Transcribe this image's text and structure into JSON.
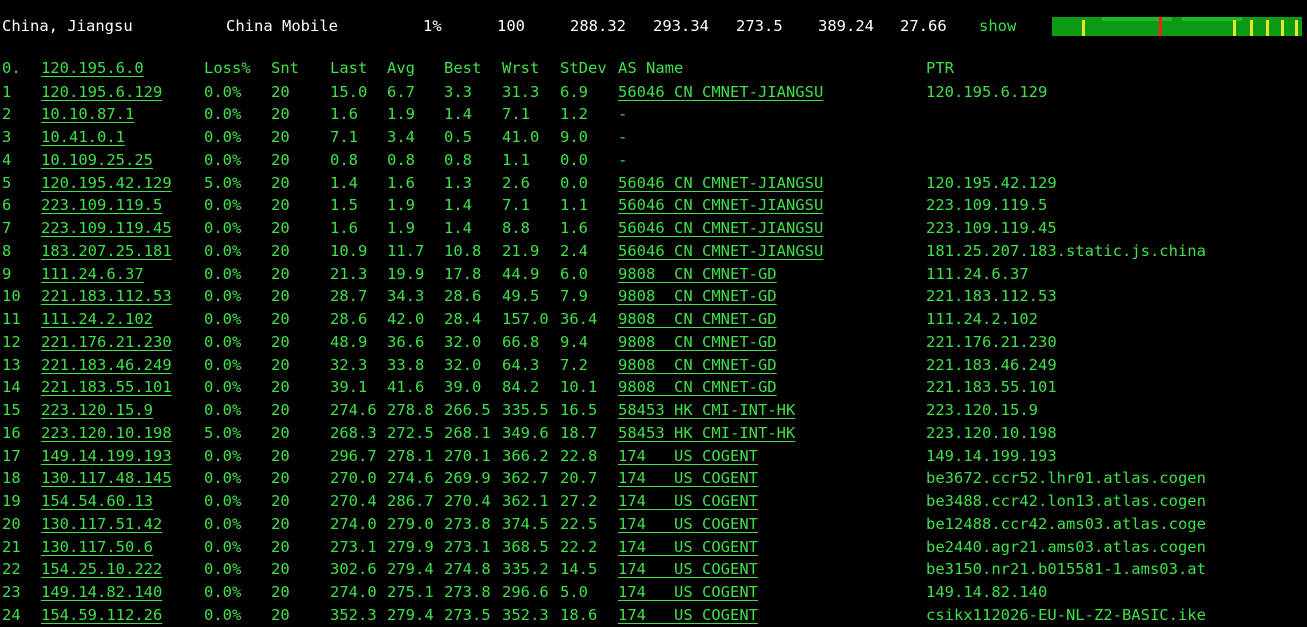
{
  "summary": {
    "location": "China, Jiangsu",
    "isp": "China Mobile",
    "loss": "1%",
    "sent": "100",
    "last": "288.32",
    "avg": "293.34",
    "best": "273.5",
    "worst": "389.24",
    "stdev": "27.66",
    "show_label": "show"
  },
  "colors": {
    "text": "#3fe04a",
    "background": "#000000",
    "graph_bg": "#0a9a14",
    "graph_tick": "#e8e62b",
    "graph_peak": "#ff1a1a"
  },
  "table": {
    "headers": {
      "hop": "0.",
      "host": "120.195.6.0",
      "loss": "Loss%",
      "snt": "Snt",
      "last": "Last",
      "avg": "Avg",
      "best": "Best",
      "wrst": "Wrst",
      "stdev": "StDev",
      "as": "AS Name",
      "ptr": "PTR"
    },
    "rows": [
      {
        "hop": "1",
        "host": "120.195.6.129",
        "loss": "0.0%",
        "snt": "20",
        "last": "15.0",
        "avg": "6.7",
        "best": "3.3",
        "wrst": "31.3",
        "stdev": "6.9",
        "as": "56046 CN CMNET-JIANGSU",
        "ptr": "120.195.6.129"
      },
      {
        "hop": "2",
        "host": "10.10.87.1",
        "loss": "0.0%",
        "snt": "20",
        "last": "1.6",
        "avg": "1.9",
        "best": "1.4",
        "wrst": "7.1",
        "stdev": "1.2",
        "as": "-",
        "ptr": ""
      },
      {
        "hop": "3",
        "host": "10.41.0.1",
        "loss": "0.0%",
        "snt": "20",
        "last": "7.1",
        "avg": "3.4",
        "best": "0.5",
        "wrst": "41.0",
        "stdev": "9.0",
        "as": "-",
        "ptr": ""
      },
      {
        "hop": "4",
        "host": "10.109.25.25",
        "loss": "0.0%",
        "snt": "20",
        "last": "0.8",
        "avg": "0.8",
        "best": "0.8",
        "wrst": "1.1",
        "stdev": "0.0",
        "as": "-",
        "ptr": ""
      },
      {
        "hop": "5",
        "host": "120.195.42.129",
        "loss": "5.0%",
        "snt": "20",
        "last": "1.4",
        "avg": "1.6",
        "best": "1.3",
        "wrst": "2.6",
        "stdev": "0.0",
        "as": "56046 CN CMNET-JIANGSU",
        "ptr": "120.195.42.129"
      },
      {
        "hop": "6",
        "host": "223.109.119.5",
        "loss": "0.0%",
        "snt": "20",
        "last": "1.5",
        "avg": "1.9",
        "best": "1.4",
        "wrst": "7.1",
        "stdev": "1.1",
        "as": "56046 CN CMNET-JIANGSU",
        "ptr": "223.109.119.5"
      },
      {
        "hop": "7",
        "host": "223.109.119.45",
        "loss": "0.0%",
        "snt": "20",
        "last": "1.6",
        "avg": "1.9",
        "best": "1.4",
        "wrst": "8.8",
        "stdev": "1.6",
        "as": "56046 CN CMNET-JIANGSU",
        "ptr": "223.109.119.45"
      },
      {
        "hop": "8",
        "host": "183.207.25.181",
        "loss": "0.0%",
        "snt": "20",
        "last": "10.9",
        "avg": "11.7",
        "best": "10.8",
        "wrst": "21.9",
        "stdev": "2.4",
        "as": "56046 CN CMNET-JIANGSU",
        "ptr": "181.25.207.183.static.js.china"
      },
      {
        "hop": "9",
        "host": "111.24.6.37",
        "loss": "0.0%",
        "snt": "20",
        "last": "21.3",
        "avg": "19.9",
        "best": "17.8",
        "wrst": "44.9",
        "stdev": "6.0",
        "as": "9808  CN CMNET-GD",
        "ptr": "111.24.6.37"
      },
      {
        "hop": "10",
        "host": "221.183.112.53",
        "loss": "0.0%",
        "snt": "20",
        "last": "28.7",
        "avg": "34.3",
        "best": "28.6",
        "wrst": "49.5",
        "stdev": "7.9",
        "as": "9808  CN CMNET-GD",
        "ptr": "221.183.112.53"
      },
      {
        "hop": "11",
        "host": "111.24.2.102",
        "loss": "0.0%",
        "snt": "20",
        "last": "28.6",
        "avg": "42.0",
        "best": "28.4",
        "wrst": "157.0",
        "stdev": "36.4",
        "as": "9808  CN CMNET-GD",
        "ptr": "111.24.2.102"
      },
      {
        "hop": "12",
        "host": "221.176.21.230",
        "loss": "0.0%",
        "snt": "20",
        "last": "48.9",
        "avg": "36.6",
        "best": "32.0",
        "wrst": "66.8",
        "stdev": "9.4",
        "as": "9808  CN CMNET-GD",
        "ptr": "221.176.21.230"
      },
      {
        "hop": "13",
        "host": "221.183.46.249",
        "loss": "0.0%",
        "snt": "20",
        "last": "32.3",
        "avg": "33.8",
        "best": "32.0",
        "wrst": "64.3",
        "stdev": "7.2",
        "as": "9808  CN CMNET-GD",
        "ptr": "221.183.46.249"
      },
      {
        "hop": "14",
        "host": "221.183.55.101",
        "loss": "0.0%",
        "snt": "20",
        "last": "39.1",
        "avg": "41.6",
        "best": "39.0",
        "wrst": "84.2",
        "stdev": "10.1",
        "as": "9808  CN CMNET-GD",
        "ptr": "221.183.55.101"
      },
      {
        "hop": "15",
        "host": "223.120.15.9",
        "loss": "0.0%",
        "snt": "20",
        "last": "274.6",
        "avg": "278.8",
        "best": "266.5",
        "wrst": "335.5",
        "stdev": "16.5",
        "as": "58453 HK CMI-INT-HK",
        "ptr": "223.120.15.9"
      },
      {
        "hop": "16",
        "host": "223.120.10.198",
        "loss": "5.0%",
        "snt": "20",
        "last": "268.3",
        "avg": "272.5",
        "best": "268.1",
        "wrst": "349.6",
        "stdev": "18.7",
        "as": "58453 HK CMI-INT-HK",
        "ptr": "223.120.10.198"
      },
      {
        "hop": "17",
        "host": "149.14.199.193",
        "loss": "0.0%",
        "snt": "20",
        "last": "296.7",
        "avg": "278.1",
        "best": "270.1",
        "wrst": "366.2",
        "stdev": "22.8",
        "as": "174   US COGENT",
        "ptr": "149.14.199.193"
      },
      {
        "hop": "18",
        "host": "130.117.48.145",
        "loss": "0.0%",
        "snt": "20",
        "last": "270.0",
        "avg": "274.6",
        "best": "269.9",
        "wrst": "362.7",
        "stdev": "20.7",
        "as": "174   US COGENT",
        "ptr": "be3672.ccr52.lhr01.atlas.cogen"
      },
      {
        "hop": "19",
        "host": "154.54.60.13",
        "loss": "0.0%",
        "snt": "20",
        "last": "270.4",
        "avg": "286.7",
        "best": "270.4",
        "wrst": "362.1",
        "stdev": "27.2",
        "as": "174   US COGENT",
        "ptr": "be3488.ccr42.lon13.atlas.cogen"
      },
      {
        "hop": "20",
        "host": "130.117.51.42",
        "loss": "0.0%",
        "snt": "20",
        "last": "274.0",
        "avg": "279.0",
        "best": "273.8",
        "wrst": "374.5",
        "stdev": "22.5",
        "as": "174   US COGENT",
        "ptr": "be12488.ccr42.ams03.atlas.coge"
      },
      {
        "hop": "21",
        "host": "130.117.50.6",
        "loss": "0.0%",
        "snt": "20",
        "last": "273.1",
        "avg": "279.9",
        "best": "273.1",
        "wrst": "368.5",
        "stdev": "22.2",
        "as": "174   US COGENT",
        "ptr": "be2440.agr21.ams03.atlas.cogen"
      },
      {
        "hop": "22",
        "host": "154.25.10.222",
        "loss": "0.0%",
        "snt": "20",
        "last": "302.6",
        "avg": "279.4",
        "best": "274.8",
        "wrst": "335.2",
        "stdev": "14.5",
        "as": "174   US COGENT",
        "ptr": "be3150.nr21.b015581-1.ams03.at"
      },
      {
        "hop": "23",
        "host": "149.14.82.140",
        "loss": "0.0%",
        "snt": "20",
        "last": "274.0",
        "avg": "275.1",
        "best": "273.8",
        "wrst": "296.6",
        "stdev": "5.0",
        "as": "174   US COGENT",
        "ptr": "149.14.82.140"
      },
      {
        "hop": "24",
        "host": "154.59.112.26",
        "loss": "0.0%",
        "snt": "20",
        "last": "352.3",
        "avg": "279.4",
        "best": "273.5",
        "wrst": "352.3",
        "stdev": "18.6",
        "as": "174   US COGENT",
        "ptr": "csikx112026-EU-NL-Z2-BASIC.ike"
      }
    ]
  }
}
